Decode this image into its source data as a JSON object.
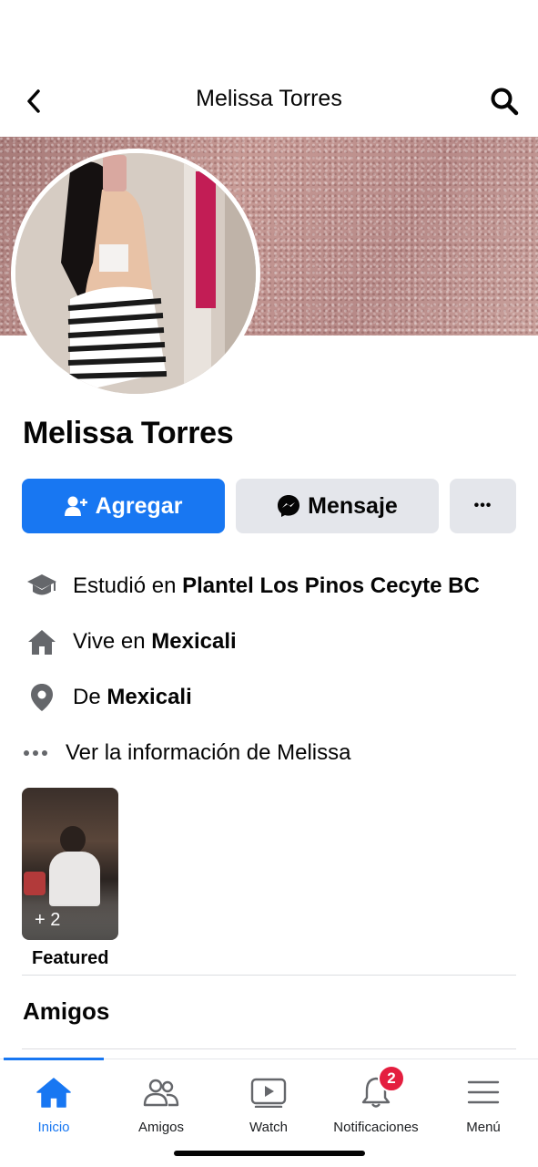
{
  "header": {
    "title": "Melissa Torres",
    "back_icon": "chevron-left-icon",
    "search_icon": "search-icon"
  },
  "profile": {
    "name": "Melissa Torres"
  },
  "actions": {
    "add_label": "Agregar",
    "message_label": "Mensaje",
    "more_label": "•••"
  },
  "info": {
    "education_prefix": "Estudió en ",
    "education_value": "Plantel Los Pinos Cecyte BC",
    "lives_prefix": "Vive en ",
    "lives_value": "Mexicali",
    "from_prefix": "De ",
    "from_value": "Mexicali",
    "see_more": "Ver la información de Melissa"
  },
  "featured": {
    "count": "+ 2",
    "label": "Featured"
  },
  "friends_section": {
    "title": "Amigos"
  },
  "nav": {
    "items": [
      {
        "label": "Inicio",
        "icon": "home-icon"
      },
      {
        "label": "Amigos",
        "icon": "friends-icon"
      },
      {
        "label": "Watch",
        "icon": "watch-icon"
      },
      {
        "label": "Notificaciones",
        "icon": "bell-icon",
        "badge": "2"
      },
      {
        "label": "Menú",
        "icon": "hamburger-menu-icon"
      }
    ]
  },
  "colors": {
    "accent": "#1877f2",
    "secondary_button": "#e4e6eb",
    "badge": "#e41e3f"
  }
}
